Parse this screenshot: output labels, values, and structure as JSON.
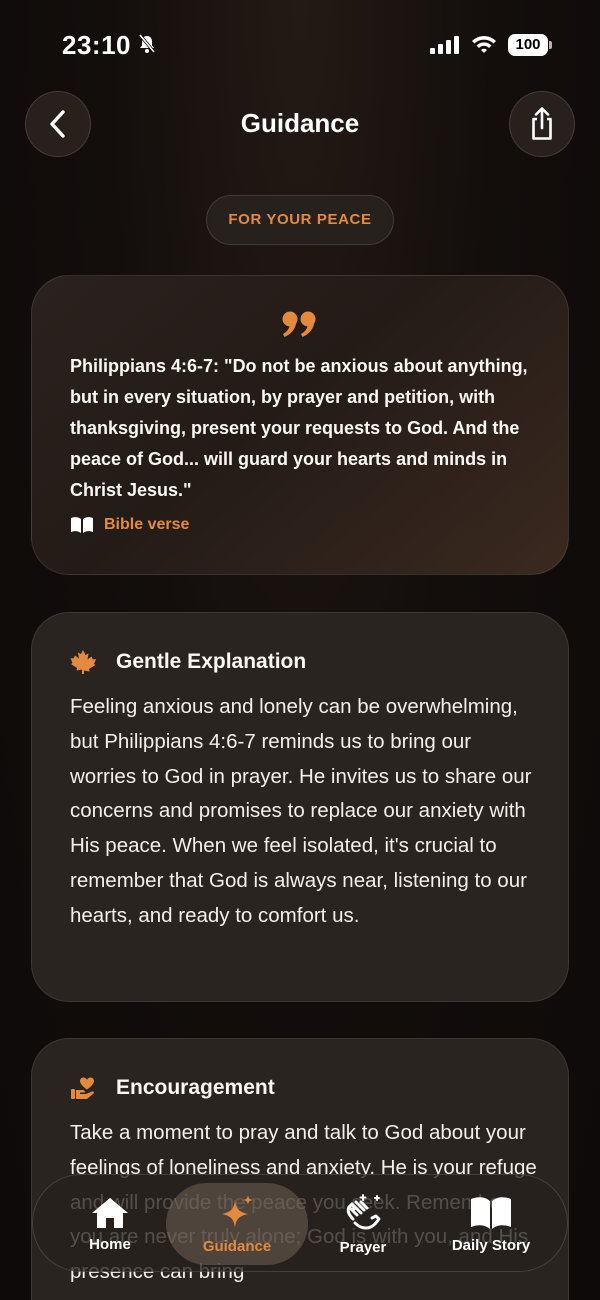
{
  "status_bar": {
    "time": "23:10",
    "battery": "100"
  },
  "header": {
    "title": "Guidance"
  },
  "pill": {
    "label": "FOR YOUR PEACE"
  },
  "verse_card": {
    "text": "Philippians 4:6-7: \"Do not be anxious about anything, but in every situation, by prayer and petition, with thanksgiving, present your requests to God. And the peace of God... will guard your hearts and minds in Christ Jesus.\"",
    "source_label": "Bible verse"
  },
  "explanation_card": {
    "title": "Gentle Explanation",
    "body": "Feeling anxious and lonely can be overwhelming, but Philippians 4:6-7 reminds us to bring our worries to God in prayer. He invites us to share our concerns and promises to replace our anxiety with His peace. When we feel isolated, it's crucial to remember that God is always near, listening to our hearts, and ready to comfort us."
  },
  "encouragement_card": {
    "title": "Encouragement",
    "body": "Take a moment to pray and talk to God about your feelings of loneliness and anxiety. He is your refuge and will provide the peace you seek. Remember, you are never truly alone; God is with you, and His presence can bring"
  },
  "tab_bar": {
    "tabs": [
      {
        "label": "Home",
        "icon": "house-icon"
      },
      {
        "label": "Guidance",
        "icon": "sparkles-icon",
        "active": true
      },
      {
        "label": "Prayer",
        "icon": "praying-hands-icon"
      },
      {
        "label": "Daily Story",
        "icon": "open-book-icon"
      }
    ]
  },
  "colors": {
    "accent": "#e48a3e",
    "background": "#130e0c",
    "card": "#2a2420"
  }
}
